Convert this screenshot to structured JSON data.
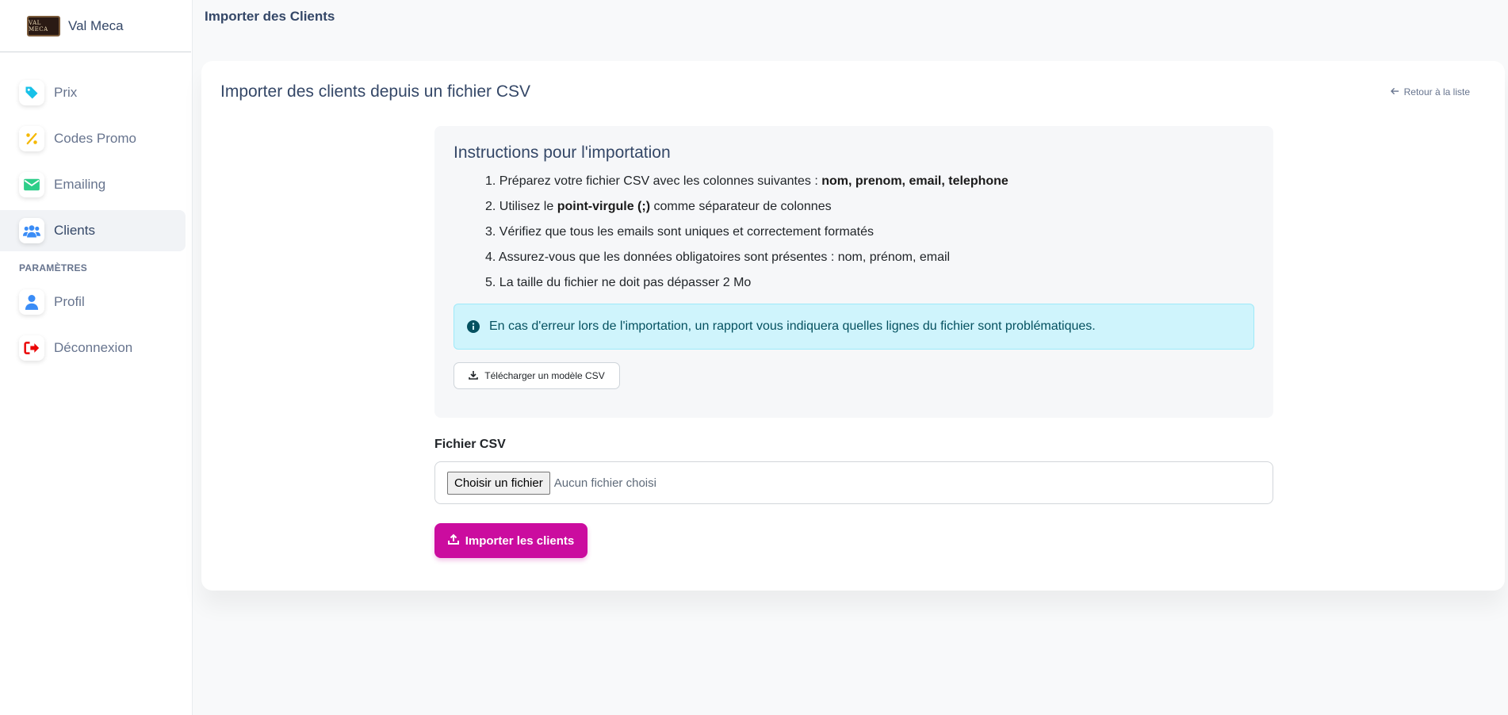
{
  "brand": {
    "name": "Val Meca",
    "logo_text": "VAL MECA"
  },
  "sidebar": {
    "items": [
      {
        "label": "Prix",
        "icon": "tag-icon",
        "color": "#17c1e8"
      },
      {
        "label": "Codes Promo",
        "icon": "percent-icon",
        "color": "#f5b800"
      },
      {
        "label": "Emailing",
        "icon": "envelope-icon",
        "color": "#2dce89"
      },
      {
        "label": "Clients",
        "icon": "users-icon",
        "color": "#3a8cf6",
        "active": true
      }
    ],
    "section_label": "PARAMÈTRES",
    "settings_items": [
      {
        "label": "Profil",
        "icon": "user-icon",
        "color": "#3a8cf6"
      },
      {
        "label": "Déconnexion",
        "icon": "logout-icon",
        "color": "#ea0606"
      }
    ]
  },
  "header": {
    "title": "Importer des Clients"
  },
  "card": {
    "title": "Importer des clients depuis un fichier CSV",
    "back_label": "Retour à la liste"
  },
  "instructions": {
    "title": "Instructions pour l'importation",
    "steps": [
      {
        "num": "1.",
        "text": "Préparez votre fichier CSV avec les colonnes suivantes : ",
        "bold": "nom, prenom, email, telephone",
        "after": ""
      },
      {
        "num": "2.",
        "text": "Utilisez le ",
        "bold": "point-virgule (;)",
        "after": " comme séparateur de colonnes"
      },
      {
        "num": "3.",
        "text": "Vérifiez que tous les emails sont uniques et correctement formatés",
        "bold": "",
        "after": ""
      },
      {
        "num": "4.",
        "text": "Assurez-vous que les données obligatoires sont présentes : nom, prénom, email",
        "bold": "",
        "after": ""
      },
      {
        "num": "5.",
        "text": "La taille du fichier ne doit pas dépasser 2 Mo",
        "bold": "",
        "after": ""
      }
    ],
    "alert": "En cas d'erreur lors de l'importation, un rapport vous indiquera quelles lignes du fichier sont problématiques.",
    "template_button": "Télécharger un modèle CSV"
  },
  "form": {
    "file_label": "Fichier CSV",
    "choose_button": "Choisir un fichier",
    "file_status": "Aucun fichier choisi",
    "submit_label": "Importer les clients"
  }
}
